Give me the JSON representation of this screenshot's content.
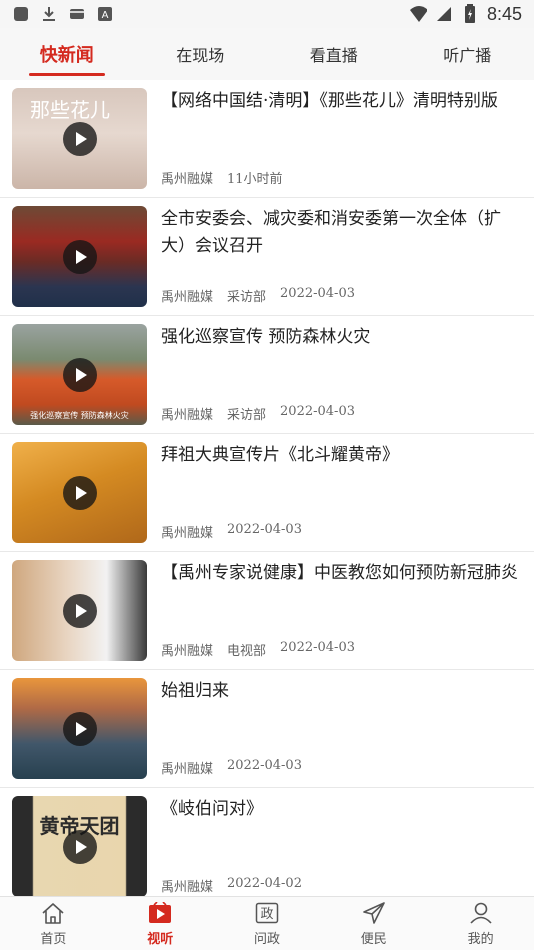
{
  "status_bar": {
    "time": "8:45",
    "left_icons": [
      "app-icon",
      "download-icon",
      "mail-icon",
      "translate-icon"
    ],
    "right_icons": [
      "wifi-icon",
      "signal-icon",
      "battery-icon"
    ]
  },
  "tabs": [
    {
      "label": "快新闻",
      "active": true
    },
    {
      "label": "在现场",
      "active": false
    },
    {
      "label": "看直播",
      "active": false
    },
    {
      "label": "听广播",
      "active": false
    }
  ],
  "news": [
    {
      "title": "【网络中国结·清明】《那些花儿》清明特别版",
      "source": "禹州融媒",
      "dept": "",
      "time": "11小时前",
      "thumb_text": "那些花儿"
    },
    {
      "title": "全市安委会、减灾委和消安委第一次全体（扩大）会议召开",
      "source": "禹州融媒",
      "dept": "采访部",
      "time": "2022-04-03",
      "thumb_text": ""
    },
    {
      "title": "强化巡察宣传 预防森林火灾",
      "source": "禹州融媒",
      "dept": "采访部",
      "time": "2022-04-03",
      "thumb_text": "强化巡察宣传 预防森林火灾"
    },
    {
      "title": "拜祖大典宣传片《北斗耀黄帝》",
      "source": "禹州融媒",
      "dept": "",
      "time": "2022-04-03",
      "thumb_text": ""
    },
    {
      "title": "【禹州专家说健康】中医教您如何预防新冠肺炎",
      "source": "禹州融媒",
      "dept": "电视部",
      "time": "2022-04-03",
      "thumb_text": ""
    },
    {
      "title": "始祖归来",
      "source": "禹州融媒",
      "dept": "",
      "time": "2022-04-03",
      "thumb_text": ""
    },
    {
      "title": "《岐伯问对》",
      "source": "禹州融媒",
      "dept": "",
      "time": "2022-04-02",
      "thumb_text": "黄帝天团"
    }
  ],
  "bottom_nav": [
    {
      "label": "首页",
      "icon": "home-icon",
      "active": false
    },
    {
      "label": "视听",
      "icon": "video-icon",
      "active": true
    },
    {
      "label": "问政",
      "icon": "government-icon",
      "active": false
    },
    {
      "label": "便民",
      "icon": "send-icon",
      "active": false
    },
    {
      "label": "我的",
      "icon": "user-icon",
      "active": false
    }
  ],
  "colors": {
    "accent": "#d42a1f",
    "text": "#222222",
    "meta": "#666666"
  }
}
